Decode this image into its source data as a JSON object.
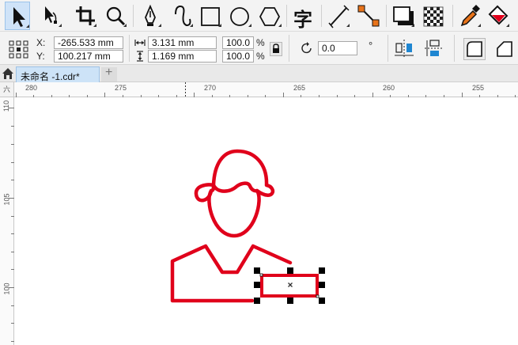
{
  "toolbar": {
    "tools": [
      {
        "name": "pick-tool",
        "icon": "arrow-pointer-icon",
        "active": true
      },
      {
        "name": "shape-tool",
        "icon": "node-edit-icon"
      },
      {
        "name": "crop-tool",
        "icon": "crop-icon"
      },
      {
        "name": "zoom-tool",
        "icon": "magnifier-icon"
      },
      {
        "name": "pen-tool",
        "icon": "pen-nib-icon"
      },
      {
        "name": "artistic-media-tool",
        "icon": "curve-icon"
      },
      {
        "name": "rectangle-tool",
        "icon": "rectangle-icon"
      },
      {
        "name": "ellipse-tool",
        "icon": "ellipse-icon"
      },
      {
        "name": "polygon-tool",
        "icon": "hexagon-icon"
      },
      {
        "name": "text-tool",
        "icon": "text-glyph-icon",
        "glyph": "字"
      },
      {
        "name": "dimension-tool",
        "icon": "dimension-line-icon"
      },
      {
        "name": "connector-tool",
        "icon": "connector-icon"
      },
      {
        "name": "drop-shadow-tool",
        "icon": "drop-shadow-icon"
      },
      {
        "name": "transparency-tool",
        "icon": "checkerboard-icon"
      },
      {
        "name": "color-eyedropper-tool",
        "icon": "eyedropper-icon"
      },
      {
        "name": "interactive-fill-tool",
        "icon": "fill-bucket-icon"
      }
    ]
  },
  "property_bar": {
    "x_label": "X:",
    "x_value": "-265.533 mm",
    "y_label": "Y:",
    "y_value": "100.217 mm",
    "width_value": "3.131 mm",
    "height_value": "1.169 mm",
    "scale_x": "100.0",
    "scale_y": "100.0",
    "percent_symbol": "%",
    "rotation_value": "0.0",
    "degree_symbol": "°"
  },
  "tabs": {
    "active_tab": "未命名 -1.cdr*",
    "add_symbol": "+"
  },
  "ruler": {
    "horizontal": [
      "280",
      "275",
      "270",
      "265",
      "260",
      "255"
    ],
    "vertical": [
      "110",
      "105",
      "100"
    ],
    "corner_glyph": "六"
  },
  "colors": {
    "artwork_red": "#e0001b",
    "selection_handle": "#000000",
    "toolbar_bg": "#f3f3f3",
    "active_tab_bg": "#cde3f7"
  }
}
